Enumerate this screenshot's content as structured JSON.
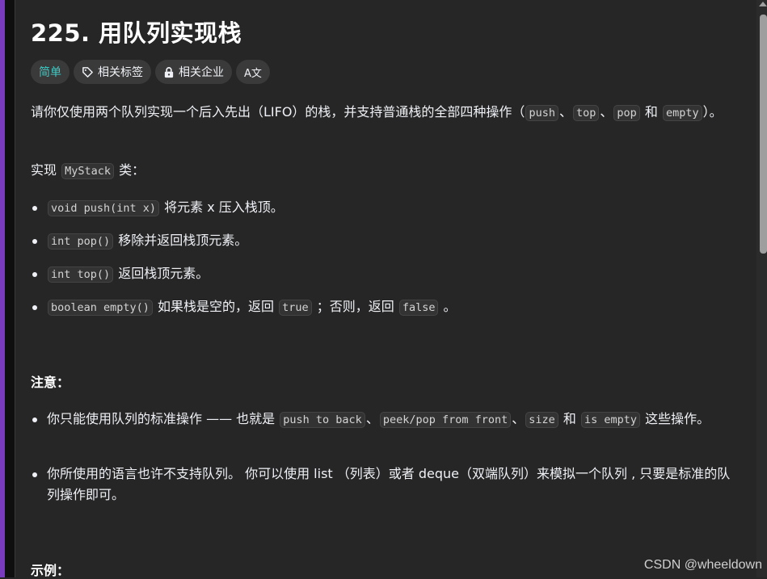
{
  "problem": {
    "title": "225. 用队列实现栈",
    "tags": {
      "difficulty": "简单",
      "related_tags": "相关标签",
      "related_companies": "相关企业",
      "translate": "A文"
    }
  },
  "description": {
    "intro": {
      "text1": "请你仅使用两个队列实现一个后入先出（LIFO）的栈，并支持普通栈的全部四种操作（",
      "code_push": "push",
      "sep1": "、",
      "code_top": "top",
      "sep2": "、",
      "code_pop": "pop",
      "and": " 和 ",
      "code_empty": "empty",
      "end": "）。"
    },
    "implement": {
      "prefix": "实现 ",
      "code": "MyStack",
      "suffix": " 类："
    },
    "methods": [
      {
        "code": "void push(int x)",
        "text": " 将元素 x 压入栈顶。"
      },
      {
        "code": "int pop()",
        "text": " 移除并返回栈顶元素。"
      },
      {
        "code": "int top()",
        "text": " 返回栈顶元素。"
      },
      {
        "code": "boolean empty()",
        "text": " 如果栈是空的，返回 ",
        "code2": "true",
        "text2": " ；否则，返回 ",
        "code3": "false",
        "text3": " 。"
      }
    ],
    "notes_heading": "注意：",
    "notes": [
      {
        "text1": "你只能使用队列的标准操作 —— 也就是 ",
        "code1": "push to back",
        "sep1": "、",
        "code2": "peek/pop from front",
        "sep2": "、",
        "code3": "size",
        "and": " 和 ",
        "code4": "is empty",
        "text2": " 这些操作。"
      },
      {
        "text": "你所使用的语言也许不支持队列。 你可以使用 list （列表）或者 deque（双端队列）来模拟一个队列 , 只要是标准的队列操作即可。"
      }
    ],
    "example_heading": "示例："
  },
  "watermark": "CSDN @wheeldown",
  "colors": {
    "background": "#262626",
    "accent": "#7b3bbf",
    "easy": "#46c6c2"
  }
}
